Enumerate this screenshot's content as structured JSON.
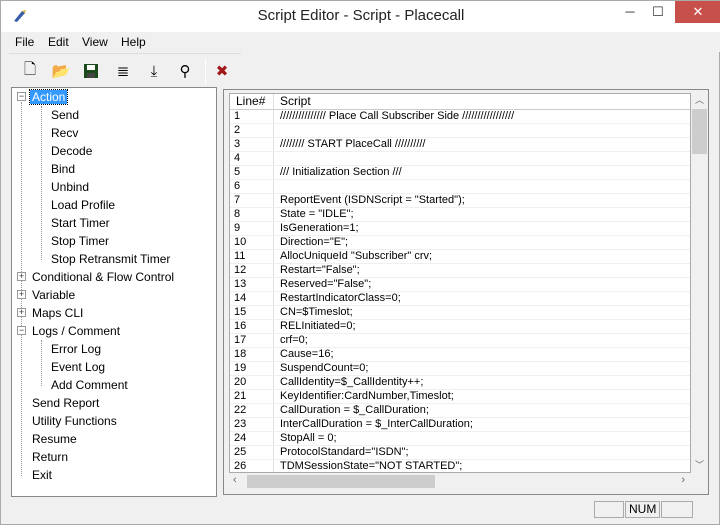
{
  "window": {
    "title": "Script Editor - Script - Placecall",
    "minimize": "─",
    "maximize": "☐",
    "close": "✕"
  },
  "menu": [
    "File",
    "Edit",
    "View",
    "Help"
  ],
  "toolbar": {
    "new": "🗋",
    "open": "📂",
    "save": "💾",
    "insert": "≣",
    "wrap": "⤓",
    "find": "⚲",
    "delete": "✖"
  },
  "tree": {
    "action": {
      "label": "Action",
      "children": [
        "Send",
        "Recv",
        "Decode",
        "Bind",
        "Unbind",
        "Load Profile",
        "Start Timer",
        "Stop Timer",
        "Stop Retransmit Timer"
      ]
    },
    "collapsed": [
      "Conditional & Flow Control",
      "Variable",
      "Maps CLI"
    ],
    "logs": {
      "label": "Logs / Comment",
      "children": [
        "Error Log",
        "Event Log",
        "Add Comment"
      ]
    },
    "leaves": [
      "Send Report",
      "Utility Functions",
      "Resume",
      "Return",
      "Exit"
    ]
  },
  "grid": {
    "headers": [
      "Line#",
      "Script"
    ],
    "rows": [
      [
        "1",
        "/////////////// Place Call Subscriber Side /////////////////"
      ],
      [
        "2",
        ""
      ],
      [
        "3",
        "//////// START PlaceCall //////////"
      ],
      [
        "4",
        ""
      ],
      [
        "5",
        "/// Initialization Section ///"
      ],
      [
        "6",
        ""
      ],
      [
        "7",
        "ReportEvent (ISDNScript = \"Started\");"
      ],
      [
        "8",
        "State = \"IDLE\";"
      ],
      [
        "9",
        "IsGeneration=1;"
      ],
      [
        "10",
        "Direction=\"E\";"
      ],
      [
        "11",
        "AllocUniqueId \"Subscriber\" crv;"
      ],
      [
        "12",
        "Restart=\"False\";"
      ],
      [
        "13",
        "Reserved=\"False\";"
      ],
      [
        "14",
        "RestartIndicatorClass=0;"
      ],
      [
        "15",
        "CN=$Timeslot;"
      ],
      [
        "16",
        "RELInitiated=0;"
      ],
      [
        "17",
        "crf=0;"
      ],
      [
        "18",
        "Cause=16;"
      ],
      [
        "19",
        "SuspendCount=0;"
      ],
      [
        "20",
        "CallIdentity=$_CallIdentity++;"
      ],
      [
        "21",
        "KeyIdentifier:CardNumber,Timeslot;"
      ],
      [
        "22",
        "CallDuration = $_CallDuration;"
      ],
      [
        "23",
        "InterCallDuration = $_InterCallDuration;"
      ],
      [
        "24",
        "StopAll = 0;"
      ],
      [
        "25",
        "ProtocolStandard=\"ISDN\";"
      ],
      [
        "26",
        "TDMSessionState=\"NOT STARTED\";"
      ]
    ]
  },
  "status": {
    "num": "NUM"
  }
}
